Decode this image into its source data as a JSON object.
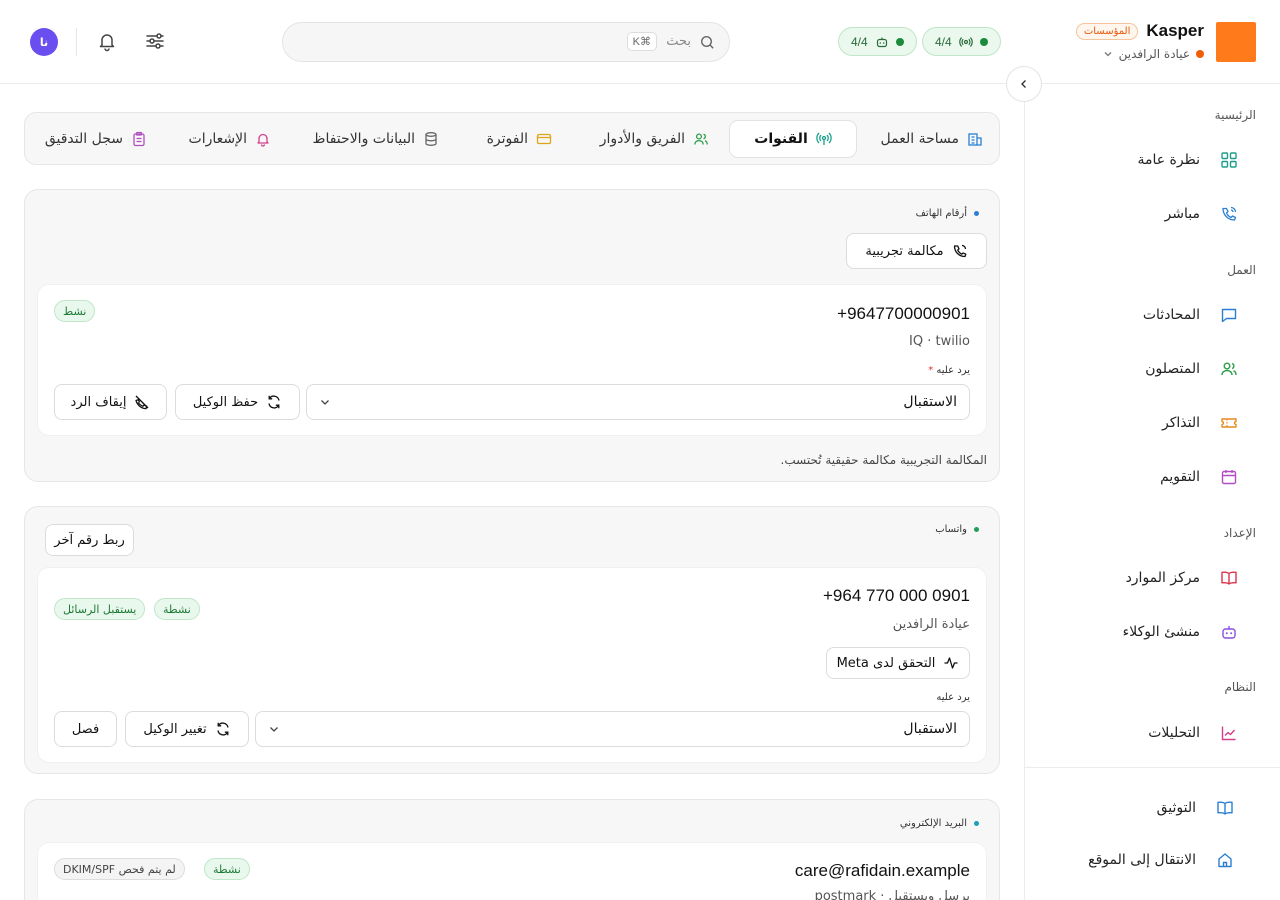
{
  "brand": {
    "name": "Kasper",
    "badge": "المؤسسات",
    "org": "عيادة الرافدين",
    "logo_color": "#ff7a1a"
  },
  "status": {
    "channels_count": "4/4",
    "agents_count": "4/4"
  },
  "search": {
    "placeholder": "بحث",
    "shortcut": "⌘K"
  },
  "user": {
    "initials": "نا",
    "avatar_color": "#6b4ef0"
  },
  "sidebar": {
    "sections": {
      "main": "الرئيسية",
      "work": "العمل",
      "setup": "الإعداد",
      "system": "النظام"
    },
    "items": {
      "overview": "نظرة عامة",
      "live": "مباشر",
      "conversations": "المحادثات",
      "contacts": "المتصلون",
      "tickets": "التذاكر",
      "calendar": "التقويم",
      "resources": "مركز الموارد",
      "agent_builder": "منشئ الوكلاء",
      "analytics": "التحليلات",
      "docs": "التوثيق",
      "go_to_site": "الانتقال إلى الموقع"
    }
  },
  "tabs": {
    "workspace": "مساحة العمل",
    "channels": "القنوات",
    "team": "الفريق والأدوار",
    "billing": "الفوترة",
    "data": "البيانات والاحتفاظ",
    "notifications": "الإشعارات",
    "audit": "سجل التدقيق"
  },
  "phone_section": {
    "title": "أرقام الهاتف",
    "test_call": "مكالمة تجريبية",
    "number": "+9647700000901",
    "provider": "IQ · twilio",
    "status": "نشط",
    "field_label": "يرد عليه",
    "agent": "الاستقبال",
    "save_agent": "حفظ الوكيل",
    "stop_reply": "إيقاف الرد",
    "note": "المكالمة التجريبية مكالمة حقيقية تُحتسب."
  },
  "whatsapp_section": {
    "title": "واتساب",
    "link_another": "ربط رقم آخر",
    "number": "+964 770 000 0901",
    "business_name": "عيادة الرافدين",
    "badge_active": "نشطة",
    "badge_receives": "يستقبل الرسائل",
    "verify": "التحقق لدى Meta",
    "field_label": "يرد عليه",
    "agent": "الاستقبال",
    "change_agent": "تغيير الوكيل",
    "disconnect": "فصل"
  },
  "email_section": {
    "title": "البريد الإلكتروني",
    "address": "care@rafidain.example",
    "badge_active": "نشطة",
    "badge_dkim": "لم يتم فحص DKIM/SPF",
    "sub": "يرسل ويستقبل · postmark"
  }
}
